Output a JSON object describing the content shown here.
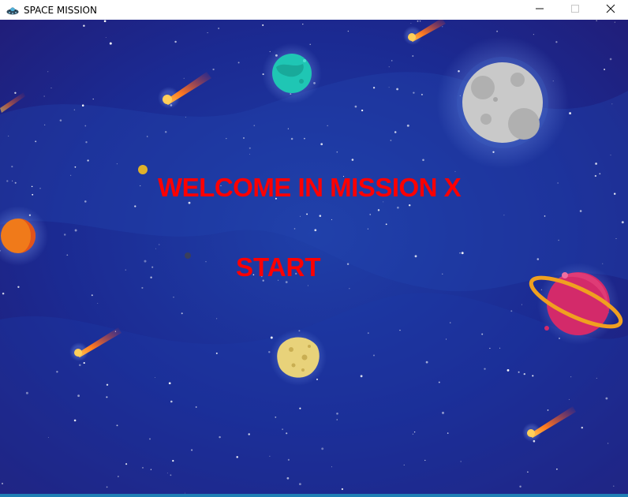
{
  "window": {
    "title": "SPACE MISSION",
    "controls": [
      "minimize",
      "maximize",
      "close"
    ]
  },
  "game": {
    "heading": "WELCOME IN MISSION X",
    "start_label": "START",
    "text_color": "#ff0000",
    "background_color": "#1b1f8a",
    "objects": [
      "comet",
      "comet",
      "comet",
      "comet",
      "comet",
      "teal-planet",
      "moon",
      "orange-planet",
      "ringed-planet",
      "asteroid"
    ]
  },
  "colors": {
    "accent_bar": "#1f7fb5"
  }
}
